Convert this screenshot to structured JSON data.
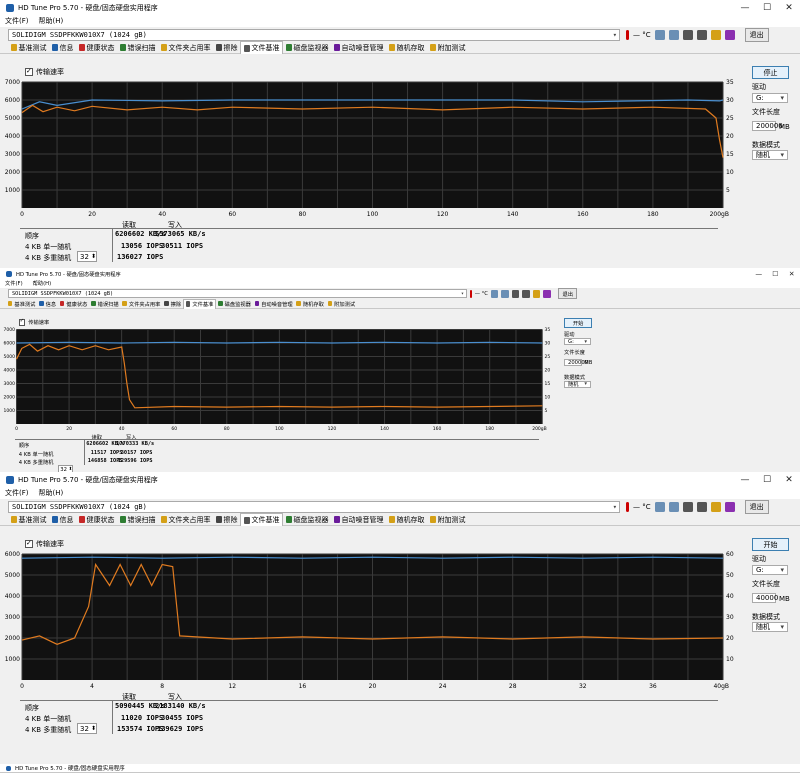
{
  "app": {
    "title": "HD Tune Pro 5.70 - 硬盘/固态硬盘实用程序",
    "menu": [
      "文件(F)",
      "帮助(H)"
    ],
    "drive": "SOLIDIGM SSDPFKKW010X7 (1024 gB)",
    "temp": "— °C",
    "exit_label": "退出",
    "tabs": [
      "基准测试",
      "信息",
      "健康状态",
      "错误扫描",
      "文件夹占用率",
      "擦除",
      "文件基准",
      "磁盘监视器",
      "自动噪音管理",
      "随机存取",
      "附加测试"
    ],
    "active_tab": "文件基准",
    "checkbox_label": "传输速率",
    "colors": {
      "read": "#4a8fd0",
      "write": "#e07b20",
      "plot_bg": "#111111",
      "grid": "#3a3a3a"
    }
  },
  "labels": {
    "col_read": "读取",
    "col_write": "写入",
    "row_seq": "顺序",
    "row_4k": "4 KB 单一随机",
    "row_4k_multi": "4 KB 多重随机",
    "drive_label": "驱动",
    "file_len_label": "文件长度",
    "mb_unit": "MB",
    "data_mode_label": "数据模式",
    "drive_value": "G:",
    "data_mode_value": "随机"
  },
  "panels": [
    {
      "button_label": "停止",
      "file_length": "200000",
      "queue_depth": "32",
      "seq_read": "6206602 KB/s",
      "seq_write": "5573065 KB/s",
      "rand_read": "13056 IOPS",
      "rand_write": "30511 IOPS",
      "multi_read": "136027 IOPS",
      "multi_write": ""
    },
    {
      "button_label": "开始",
      "file_length": "200000",
      "queue_depth": "32",
      "seq_read": "6206602 KB/s",
      "seq_write": "1770333 KB/s",
      "rand_read": "11517 IOPS",
      "rand_write": "30157 IOPS",
      "multi_read": "146858 IOPS",
      "multi_write": "129596 IOPS"
    },
    {
      "button_label": "开始",
      "file_length": "40000",
      "queue_depth": "32",
      "seq_read": "5090445 KB/s",
      "seq_write": "2183140 KB/s",
      "rand_read": "11020 IOPS",
      "rand_write": "30455 IOPS",
      "multi_read": "153574 IOPS",
      "multi_write": "139629 IOPS"
    }
  ],
  "chart_data": [
    {
      "type": "line",
      "x_unit": "gB",
      "xlim": [
        0,
        200
      ],
      "ylim": [
        0,
        7000
      ],
      "y2lim": [
        0,
        35
      ],
      "x_ticks": [
        "0",
        "20",
        "40",
        "60",
        "80",
        "100",
        "120",
        "140",
        "160",
        "180",
        "200gB"
      ],
      "y_ticks": [
        "1000",
        "2000",
        "3000",
        "4000",
        "5000",
        "6000",
        "7000"
      ],
      "y2_ticks": [
        "5",
        "10",
        "15",
        "20",
        "25",
        "30",
        "35"
      ],
      "grid": true,
      "series": [
        {
          "color": "#4a8fd0",
          "points": [
            [
              0,
              5500
            ],
            [
              5,
              5900
            ],
            [
              10,
              5700
            ],
            [
              20,
              6000
            ],
            [
              40,
              5950
            ],
            [
              60,
              6000
            ],
            [
              100,
              6000
            ],
            [
              140,
              6000
            ],
            [
              160,
              5900
            ],
            [
              190,
              6000
            ],
            [
              199,
              5950
            ],
            [
              200,
              6000
            ]
          ]
        },
        {
          "color": "#e07b20",
          "points": [
            [
              0,
              5300
            ],
            [
              3,
              5700
            ],
            [
              6,
              5350
            ],
            [
              10,
              5600
            ],
            [
              15,
              5400
            ],
            [
              20,
              5650
            ],
            [
              30,
              5450
            ],
            [
              40,
              5600
            ],
            [
              50,
              5450
            ],
            [
              60,
              5600
            ],
            [
              80,
              5500
            ],
            [
              100,
              5600
            ],
            [
              120,
              5450
            ],
            [
              140,
              5600
            ],
            [
              160,
              5500
            ],
            [
              180,
              5600
            ],
            [
              195,
              5500
            ],
            [
              198,
              5000
            ],
            [
              199,
              3800
            ],
            [
              200,
              2800
            ]
          ]
        }
      ]
    },
    {
      "type": "line",
      "x_unit": "gB",
      "xlim": [
        0,
        200
      ],
      "ylim": [
        0,
        7000
      ],
      "y2lim": [
        0,
        35
      ],
      "x_ticks": [
        "0",
        "20",
        "40",
        "60",
        "80",
        "100",
        "120",
        "140",
        "160",
        "180",
        "200gB"
      ],
      "y_ticks": [
        "1000",
        "2000",
        "3000",
        "4000",
        "5000",
        "6000",
        "7000"
      ],
      "y2_ticks": [
        "5",
        "10",
        "15",
        "20",
        "25",
        "30",
        "35"
      ],
      "grid": true,
      "series": [
        {
          "color": "#4a8fd0",
          "points": [
            [
              0,
              6000
            ],
            [
              20,
              6050
            ],
            [
              40,
              6000
            ],
            [
              60,
              6050
            ],
            [
              80,
              6000
            ],
            [
              100,
              6050
            ],
            [
              120,
              6000
            ],
            [
              140,
              6050
            ],
            [
              160,
              6000
            ],
            [
              180,
              6050
            ],
            [
              200,
              6000
            ]
          ]
        },
        {
          "color": "#e07b20",
          "points": [
            [
              0,
              4800
            ],
            [
              2,
              5600
            ],
            [
              5,
              5900
            ],
            [
              8,
              5400
            ],
            [
              12,
              5800
            ],
            [
              16,
              5500
            ],
            [
              20,
              5800
            ],
            [
              25,
              5500
            ],
            [
              30,
              5800
            ],
            [
              35,
              5500
            ],
            [
              40,
              5700
            ],
            [
              41,
              4500
            ],
            [
              42,
              3000
            ],
            [
              43,
              1800
            ],
            [
              45,
              1200
            ],
            [
              60,
              1300
            ],
            [
              80,
              1250
            ],
            [
              100,
              1300
            ],
            [
              120,
              1250
            ],
            [
              140,
              1300
            ],
            [
              160,
              1250
            ],
            [
              180,
              1300
            ],
            [
              200,
              1350
            ]
          ]
        }
      ]
    },
    {
      "type": "line",
      "x_unit": "gB",
      "xlim": [
        0,
        40
      ],
      "ylim": [
        0,
        6000
      ],
      "y2lim": [
        0,
        60
      ],
      "x_ticks": [
        "0",
        "4",
        "8",
        "12",
        "16",
        "20",
        "24",
        "28",
        "32",
        "36",
        "40gB"
      ],
      "y_ticks": [
        "1000",
        "2000",
        "3000",
        "4000",
        "5000",
        "6000"
      ],
      "y2_ticks": [
        "10",
        "20",
        "30",
        "40",
        "50",
        "60"
      ],
      "grid": true,
      "series": [
        {
          "color": "#4a8fd0",
          "points": [
            [
              0,
              5800
            ],
            [
              4,
              5850
            ],
            [
              8,
              5800
            ],
            [
              12,
              5850
            ],
            [
              16,
              5800
            ],
            [
              20,
              5850
            ],
            [
              24,
              5800
            ],
            [
              28,
              5850
            ],
            [
              32,
              5800
            ],
            [
              36,
              5850
            ],
            [
              40,
              5800
            ]
          ]
        },
        {
          "color": "#e07b20",
          "points": [
            [
              0,
              1900
            ],
            [
              1,
              2100
            ],
            [
              2,
              1700
            ],
            [
              3,
              2000
            ],
            [
              3.8,
              3500
            ],
            [
              4.2,
              5500
            ],
            [
              5,
              4500
            ],
            [
              5.6,
              5500
            ],
            [
              6.2,
              4500
            ],
            [
              6.8,
              5500
            ],
            [
              7.4,
              4500
            ],
            [
              8,
              5500
            ],
            [
              8.6,
              5400
            ],
            [
              9,
              2100
            ],
            [
              12,
              1950
            ],
            [
              16,
              2050
            ],
            [
              20,
              1950
            ],
            [
              24,
              2050
            ],
            [
              28,
              1950
            ],
            [
              32,
              2050
            ],
            [
              36,
              1950
            ],
            [
              40,
              2000
            ]
          ]
        }
      ]
    }
  ]
}
